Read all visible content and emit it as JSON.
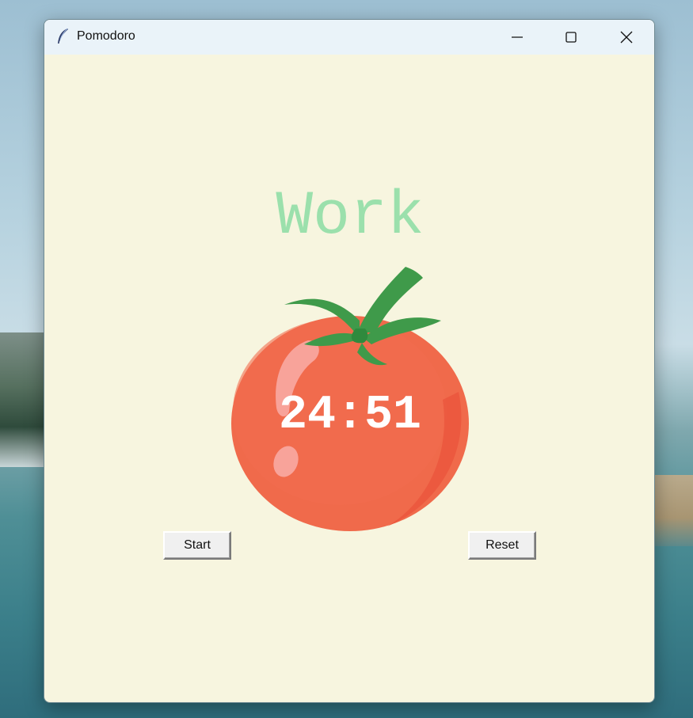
{
  "window": {
    "title": "Pomodoro",
    "app_icon": "feather-icon"
  },
  "title_controls": {
    "minimize_icon": "minimize-icon",
    "maximize_icon": "maximize-icon",
    "close_icon": "close-icon"
  },
  "main": {
    "mode_label": "Work",
    "timer": "24:51",
    "tomato_icon": "tomato-icon",
    "start_label": "Start",
    "reset_label": "Reset"
  },
  "colors": {
    "background": "#f7f5df",
    "mode_label": "#9be0ac",
    "tomato": "#f06a4b",
    "leaf": "#3f9a4a",
    "timer_text": "#ffffff"
  }
}
